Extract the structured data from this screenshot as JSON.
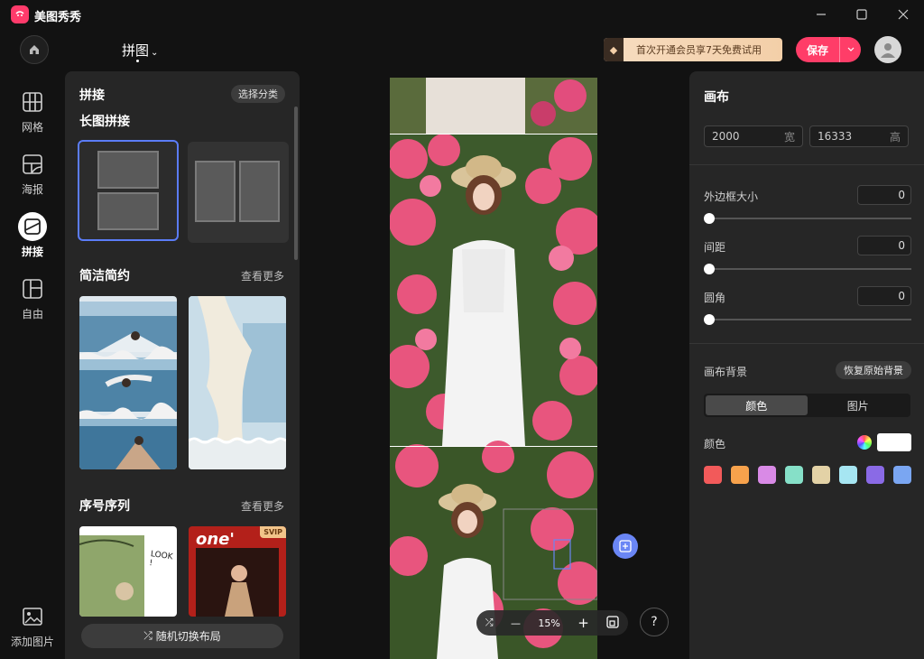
{
  "app": {
    "title": "美图秀秀"
  },
  "header": {
    "mode_title": "拼图",
    "vip_text": "首次开通会员享7天免费试用",
    "save_label": "保存"
  },
  "rail": {
    "items": [
      {
        "label": "网格",
        "icon": "grid-icon"
      },
      {
        "label": "海报",
        "icon": "poster-icon"
      },
      {
        "label": "拼接",
        "icon": "stitch-icon",
        "active": true
      },
      {
        "label": "自由",
        "icon": "freeform-icon"
      }
    ],
    "add_image_label": "添加图片"
  },
  "left_panel": {
    "title": "拼接",
    "category_button": "选择分类",
    "section_long": "长图拼接",
    "section_simple": "简洁简约",
    "section_sequence": "序号序列",
    "see_more": "查看更多",
    "svip_badge": "SVIP",
    "thumb_text_1": "one'",
    "thumb_text_2": "LOOK !",
    "shuffle_label": "随机切换布局"
  },
  "canvas": {
    "zoom": "15%"
  },
  "right_panel": {
    "title": "画布",
    "width_value": "2000",
    "width_unit": "宽",
    "height_value": "16333",
    "height_unit": "高",
    "border_label": "外边框大小",
    "border_value": "0",
    "spacing_label": "间距",
    "spacing_value": "0",
    "radius_label": "圆角",
    "radius_value": "0",
    "bg_label": "画布背景",
    "reset_bg_label": "恢复原始背景",
    "tab_color": "颜色",
    "tab_image": "图片",
    "color_label": "颜色",
    "swatches": [
      "#f25a5a",
      "#f7a24c",
      "#d98ae6",
      "#86e0c8",
      "#e3d2a6",
      "#a6e6f2",
      "#8a6ae6",
      "#7aa6f2"
    ]
  }
}
